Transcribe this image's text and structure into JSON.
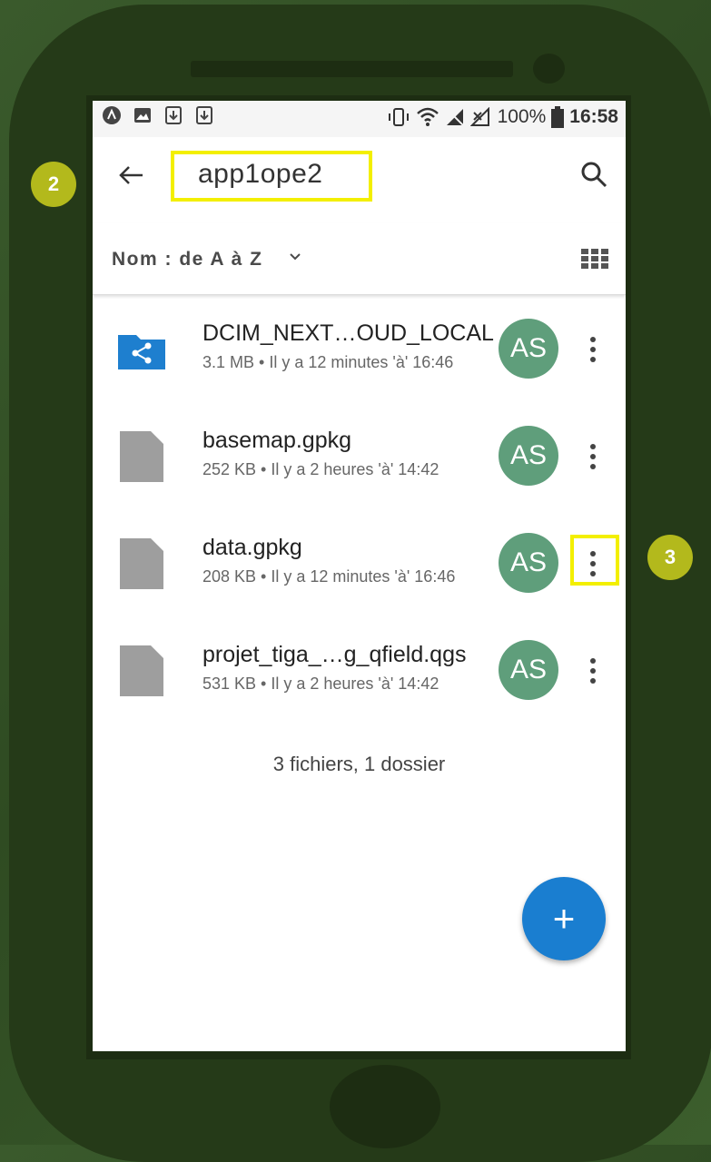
{
  "status_bar": {
    "battery": "100%",
    "time": "16:58"
  },
  "toolbar": {
    "title": "app1ope2",
    "back_icon": "arrow-left-icon",
    "search_icon": "search-icon"
  },
  "sort": {
    "label": "Nom : de A à Z",
    "view_icon": "grid-view-icon"
  },
  "files": [
    {
      "name": "DCIM_NEXT…OUD_LOCAL",
      "meta": "3.1 MB • Il y a 12 minutes 'à' 16:46",
      "icon": "shared-folder-icon",
      "avatar": "AS"
    },
    {
      "name": "basemap.gpkg",
      "meta": "252 KB • Il y a 2 heures 'à' 14:42",
      "icon": "file-icon",
      "avatar": "AS"
    },
    {
      "name": "data.gpkg",
      "meta": "208 KB • Il y a 12 minutes 'à' 16:46",
      "icon": "file-icon",
      "avatar": "AS"
    },
    {
      "name": "projet_tiga_…g_qfield.qgs",
      "meta": "531 KB • Il y a 2 heures 'à' 14:42",
      "icon": "file-icon",
      "avatar": "AS"
    }
  ],
  "summary": "3 fichiers, 1 dossier",
  "fab_label": "+",
  "annotations": {
    "badge_title": "2",
    "badge_menu": "3"
  },
  "colors": {
    "avatar": "#5f9e7b",
    "fab": "#1a7ed0",
    "highlight": "#f3ef00",
    "badge": "#b3b91c",
    "folder": "#1e7fcf"
  }
}
